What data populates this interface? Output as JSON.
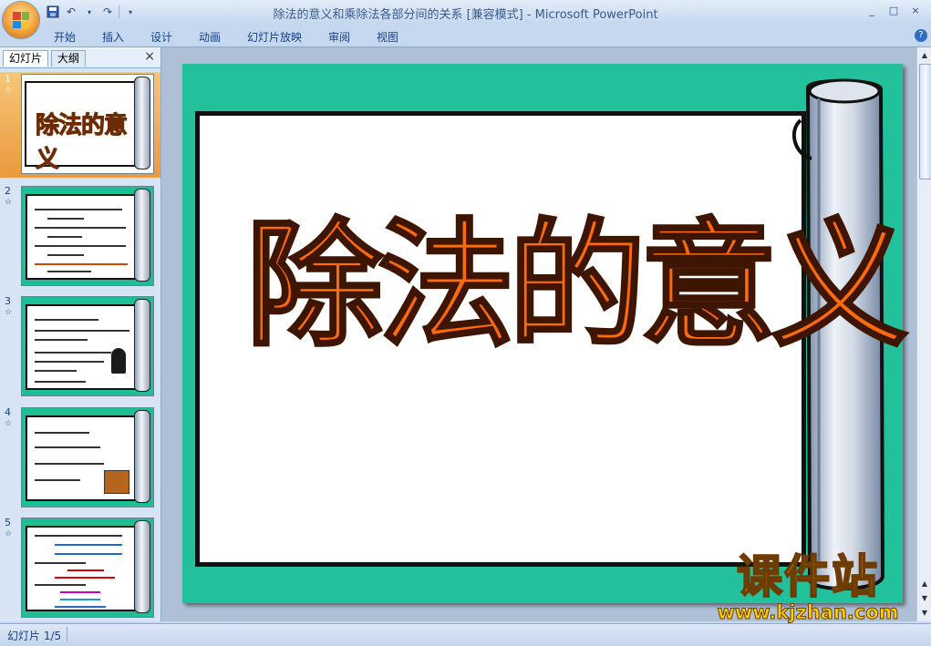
{
  "window": {
    "title": "除法的意义和乘除法各部分间的关系 [兼容模式] - Microsoft PowerPoint",
    "controls": [
      "_",
      "□",
      "×"
    ]
  },
  "ribbon": {
    "tabs": [
      "开始",
      "插入",
      "设计",
      "动画",
      "幻灯片放映",
      "审阅",
      "视图"
    ],
    "help_icon": "?"
  },
  "slides_panel": {
    "tabs": [
      "幻灯片",
      "大纲"
    ],
    "close_label": "×",
    "slides": [
      {
        "number": "1",
        "selected": true
      },
      {
        "number": "2",
        "selected": false
      },
      {
        "number": "3",
        "selected": false
      },
      {
        "number": "4",
        "selected": false
      },
      {
        "number": "5",
        "selected": false
      }
    ],
    "slide1_thumb_title": "除法的意义"
  },
  "slide": {
    "title": "除法的意义",
    "background_color": "#23c19b",
    "title_color": "#ff6a0a"
  },
  "watermark": {
    "cn": "课件站",
    "url": "www.kjzhan.com"
  },
  "status_bar": {
    "slide_indicator": "幻灯片 1/5"
  }
}
